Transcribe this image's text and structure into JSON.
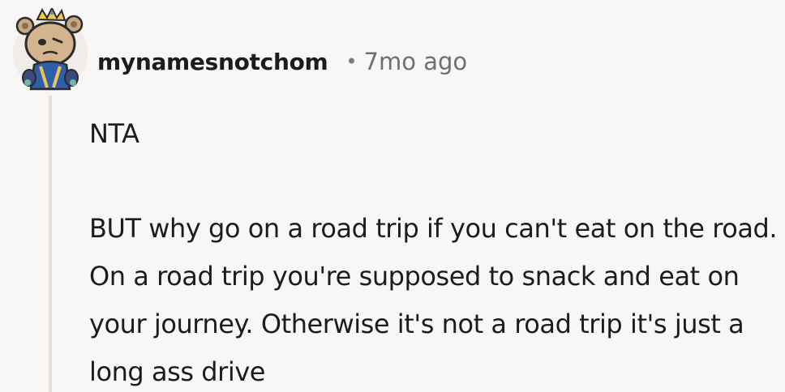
{
  "comment": {
    "author": "mynamesnotchom",
    "separator": "•",
    "timestamp": "7mo ago",
    "paragraphs": [
      "NTA",
      "BUT why go on a road trip if you can't eat on the road. On a road trip you're supposed to snack and eat on your journey. Otherwise it's not a road trip it's just a long ass drive"
    ],
    "avatar_icon": "snoo-avatar-icon"
  },
  "colors": {
    "background": "#f8f7f6",
    "thread_line": "#e6dfd9",
    "text": "#1c1c1c",
    "muted": "#6f6f6f"
  }
}
